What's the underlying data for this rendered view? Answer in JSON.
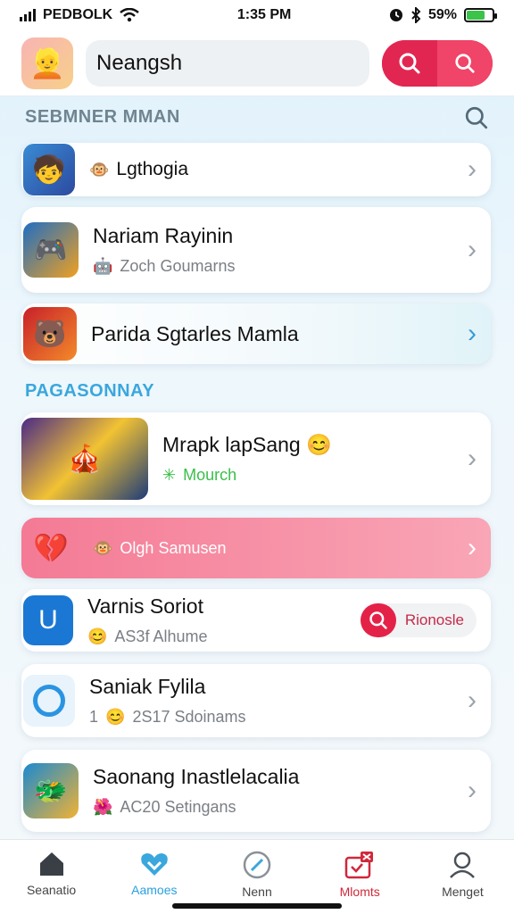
{
  "status_bar": {
    "carrier": "PEDBOLK",
    "time": "1:35 PM",
    "battery": "59%"
  },
  "header": {
    "search_value": "Neangsh",
    "avatar_icon": "avatar-icon",
    "accent_color": "#ec2f5a"
  },
  "sections": [
    {
      "title": "SEBMNER MMAN"
    },
    {
      "title": "PAGASONNAY"
    }
  ],
  "cards": [
    {
      "title": "",
      "subtitle": "Lgthogia",
      "thumb_emoji": "🧒",
      "sub_emoji": "🐵"
    },
    {
      "title": "Nariam Rayinin",
      "subtitle": "Zoch Goumarns",
      "thumb_emoji": "🎮",
      "sub_emoji": "🤖"
    },
    {
      "title": "Parida Sgtarles Mamla",
      "subtitle": "",
      "thumb_emoji": "🐻"
    },
    {
      "title": "Mrapk lapSang",
      "title_emoji": "😊",
      "subtitle": "Mourch",
      "thumb_emoji": "🎪",
      "sub_emoji": "✳"
    },
    {
      "title": "",
      "subtitle": "Olgh Samusen",
      "thumb_emoji": "💔",
      "sub_emoji": "🐵"
    },
    {
      "title": "Varnis Soriot",
      "subtitle": "AS3f Alhume",
      "thumb_emoji": "U",
      "sub_emoji": "😊",
      "action_label": "Rionosle"
    },
    {
      "title": "Saniak Fylila",
      "subtitle": "2S17 Sdoinams",
      "sub_prefix": "1",
      "sub_emoji": "😊"
    },
    {
      "title": "Saonang Inastlelacalia",
      "subtitle": "AC20 Setingans",
      "thumb_emoji": "🐲",
      "sub_emoji": "🌺"
    }
  ],
  "bottom_nav": [
    {
      "label": "Seanatio",
      "icon": "home-icon"
    },
    {
      "label": "Aamoes",
      "icon": "heart-icon"
    },
    {
      "label": "Nenn",
      "icon": "compass-icon"
    },
    {
      "label": "Mlomts",
      "icon": "inbox-alert-icon"
    },
    {
      "label": "Menget",
      "icon": "profile-icon"
    }
  ]
}
